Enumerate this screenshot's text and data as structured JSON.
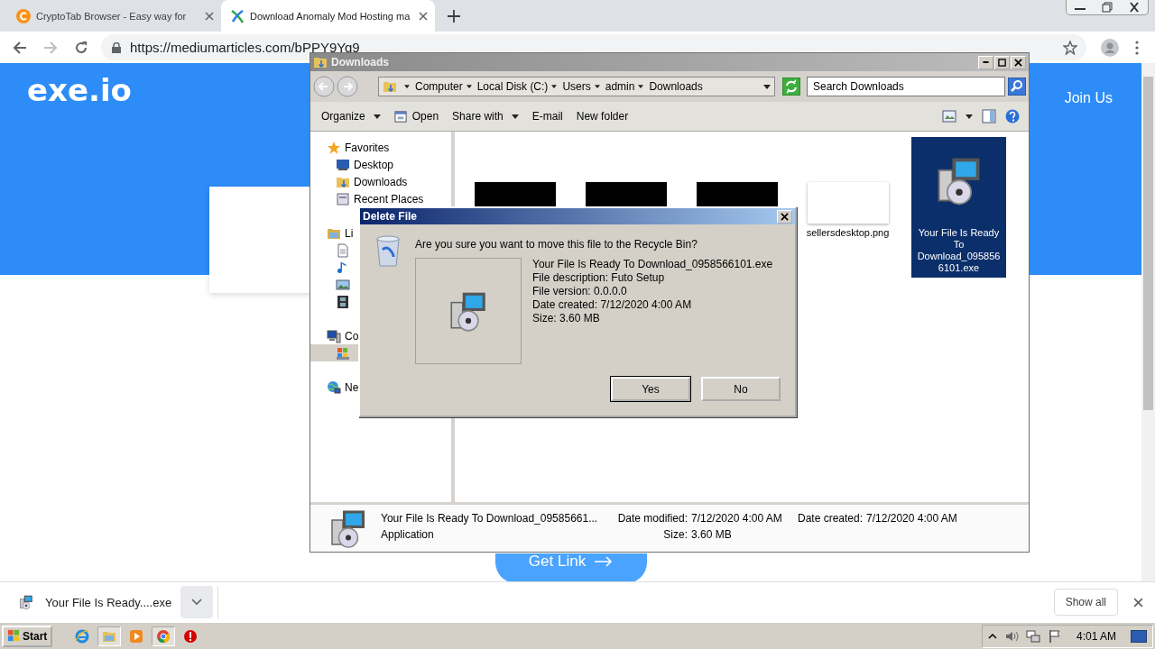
{
  "browser": {
    "tabs": [
      {
        "title": "CryptoTab Browser - Easy way for",
        "selected": false
      },
      {
        "title": "Download Anomaly Mod Hosting ma",
        "selected": true
      }
    ],
    "url": "https://mediumarticles.com/bPPY9Yq9"
  },
  "page": {
    "logo": "exe.io",
    "nav_link": "Join Us",
    "button": "Get Link"
  },
  "explorer": {
    "title": "Downloads",
    "breadcrumbs": [
      "Computer",
      "Local Disk (C:)",
      "Users",
      "admin",
      "Downloads"
    ],
    "search": {
      "placeholder": "Search Downloads"
    },
    "toolbar": [
      {
        "label": "Organize",
        "kind": "menu"
      },
      {
        "label": "Open",
        "kind": "icon"
      },
      {
        "label": "Share with",
        "kind": "menu"
      },
      {
        "label": "E-mail",
        "kind": "plain"
      },
      {
        "label": "New folder",
        "kind": "plain"
      }
    ],
    "nav": [
      {
        "label": "Favorites",
        "selected": false,
        "children": [
          {
            "label": "Desktop",
            "selected": false
          },
          {
            "label": "Downloads",
            "selected": false
          },
          {
            "label": "Recent Places",
            "selected": false
          }
        ]
      },
      {
        "label": "Li",
        "selected": false,
        "children": [
          {
            "selected": false
          },
          {
            "selected": false
          },
          {
            "selected": false
          },
          {
            "selected": false
          }
        ]
      },
      {
        "label": "Co",
        "selected": false,
        "children": [
          {
            "selected": true
          }
        ]
      },
      {
        "label": "Ne",
        "selected": false
      }
    ],
    "files": [
      {
        "kind": "thumbnail",
        "selected": false
      },
      {
        "kind": "thumbnail",
        "selected": false
      },
      {
        "kind": "thumbnail",
        "selected": false
      },
      {
        "kind": "image",
        "name": "sellersdesktop.png",
        "selected": false
      },
      {
        "kind": "program",
        "name": "Your File Is Ready To Download_0958566101.exe",
        "selected": true
      }
    ],
    "details": {
      "name": "Your File Is Ready To Download_09585661...",
      "type": "Application",
      "fields": [
        {
          "label": "Date modified:",
          "value": "7/12/2020 4:00 AM"
        },
        {
          "label": "Size:",
          "value": "3.60 MB"
        },
        {
          "label": "Date created:",
          "value": "7/12/2020 4:00 AM"
        }
      ]
    }
  },
  "dialog": {
    "title": "Delete File",
    "question": "Are you sure you want to move this file to the Recycle Bin?",
    "details": [
      "Your File Is Ready To Download_0958566101.exe",
      "File description: Futo Setup",
      "File version: 0.0.0.0",
      "Date created: 7/12/2020 4:00 AM",
      "Size: 3.60 MB"
    ],
    "buttons": [
      {
        "label": "Yes",
        "default": true
      },
      {
        "label": "No",
        "default": false
      }
    ]
  },
  "download_shelf": {
    "file": "Your File Is Ready....exe",
    "show_all": "Show all"
  },
  "taskbar": {
    "start": "Start",
    "apps": [
      {
        "kind": "ie",
        "active": false
      },
      {
        "kind": "explorer",
        "active": true
      },
      {
        "kind": "media",
        "active": false
      },
      {
        "kind": "chrome",
        "active": true
      },
      {
        "kind": "stop",
        "active": false
      }
    ],
    "clock": "4:01 AM"
  }
}
